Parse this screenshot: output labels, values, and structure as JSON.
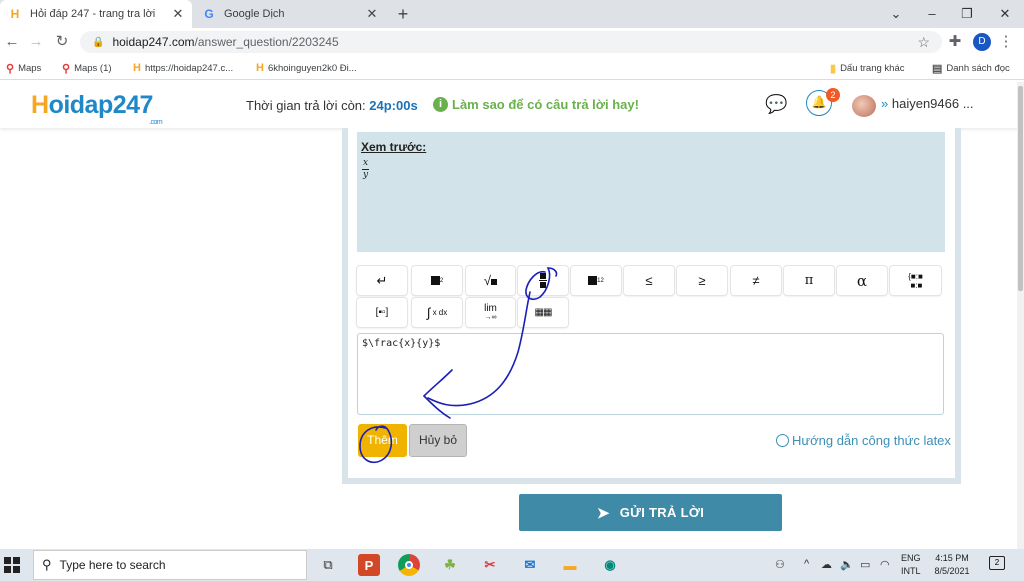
{
  "browser": {
    "tabs": [
      {
        "title": "Hỏi đáp 247 - trang tra lời",
        "active": true
      },
      {
        "title": "Google Dịch",
        "active": false
      }
    ],
    "url_host": "hoidap247.com",
    "url_path": "/answer_question/2203245",
    "profile_initial": "D",
    "bookmarks": [
      "Maps",
      "Maps (1)",
      "https://hoidap247.c...",
      "6khoinguyen2k0 Đi..."
    ],
    "bookmarks_right": [
      "Dấu trang khác",
      "Danh sách đọc"
    ]
  },
  "site": {
    "logo_h": "H",
    "logo_rest": "oidap247",
    "logo_com": ".com",
    "timer_label": "Thời gian trả lời còn:",
    "timer_value": "24p:00s",
    "tip": "Làm sao để có câu trả lời hay!",
    "notification_count": "2",
    "username": "haiyen9466 ..."
  },
  "editor": {
    "preview_title": "Xem trước:",
    "preview_num": "x",
    "preview_den": "y",
    "latex": "$\\frac{x}{y}$",
    "toolbar_row1": [
      "↵",
      "x²",
      "√x",
      "frac",
      "x₁₂",
      "≤",
      "≥",
      "≠",
      "π",
      "α",
      "matrix"
    ],
    "toolbar_labels": {
      "le": "≤",
      "ge": "≥",
      "ne": "≠",
      "pi": "π",
      "alpha": "α",
      "lim": "lim",
      "to_inf": "→∞",
      "xdx": "x dx"
    },
    "add_label": "Thêm",
    "cancel_label": "Hủy bỏ",
    "guide_label": "Hướng dẫn công thức latex",
    "submit_label": "GỬI TRẢ LỜI"
  },
  "taskbar": {
    "search_placeholder": "Type here to search",
    "lang_1": "ENG",
    "lang_2": "INTL",
    "time": "4:15 PM",
    "date": "8/5/2021",
    "notif_count": "2"
  },
  "colors": {
    "brand_blue": "#1e88c8",
    "brand_orange": "#f5a623",
    "submit_bg": "#3e8aa7",
    "add_button": "#f0b400",
    "preview_bg": "#d2e4ea",
    "tip_green": "#6ab04c",
    "scribble_ink": "#1a1fb8"
  }
}
